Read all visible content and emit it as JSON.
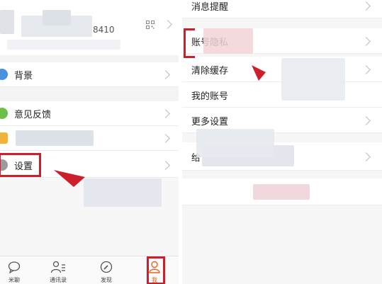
{
  "left": {
    "profile": {
      "id_fragment": "8410"
    },
    "menu": [
      {
        "label": "背景",
        "icon": "background-icon",
        "color": "#4a90e2"
      },
      {
        "label": "意见反馈",
        "icon": "feedback-icon",
        "color": "#6cc04a"
      },
      {
        "label": "",
        "icon": "wallet-icon",
        "color": "#f2b23a"
      },
      {
        "label": "设置",
        "icon": "gear-icon",
        "color": "#9b9b9b"
      }
    ],
    "tabbar": [
      {
        "label": "米聊",
        "icon": "chat-icon"
      },
      {
        "label": "通讯录",
        "icon": "contacts-icon"
      },
      {
        "label": "发现",
        "icon": "discover-icon"
      },
      {
        "label": "我",
        "icon": "me-icon",
        "active": true
      }
    ]
  },
  "right": {
    "settings": [
      {
        "label": "消息提醒"
      },
      {
        "label": "账号隐私"
      },
      {
        "label": "清除缓存"
      },
      {
        "label": "我的账号"
      },
      {
        "label": "更多设置"
      },
      {
        "label": "给"
      }
    ]
  },
  "colors": {
    "highlight": "#cc1e2b",
    "active_tab": "#e8621e"
  }
}
